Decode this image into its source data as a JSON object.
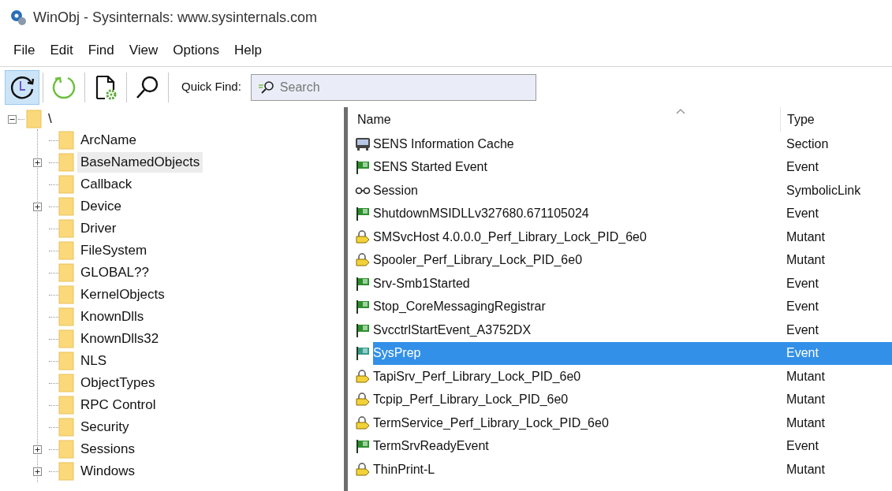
{
  "window": {
    "title": "WinObj - Sysinternals: www.sysinternals.com"
  },
  "menu": [
    "File",
    "Edit",
    "Find",
    "View",
    "Options",
    "Help"
  ],
  "toolbar": [
    {
      "kind": "history",
      "pressed": true
    },
    {
      "kind": "refresh",
      "pressed": false
    },
    {
      "kind": "properties",
      "pressed": false
    },
    {
      "kind": "find",
      "pressed": false
    }
  ],
  "quick_find": {
    "label": "Quick Find:",
    "placeholder": "Search"
  },
  "tree": {
    "label": "\\",
    "expanded": true,
    "children": [
      {
        "label": "ArcName",
        "expandable": false,
        "hovered": false
      },
      {
        "label": "BaseNamedObjects",
        "expandable": true,
        "hovered": true
      },
      {
        "label": "Callback",
        "expandable": false,
        "hovered": false
      },
      {
        "label": "Device",
        "expandable": true,
        "hovered": false
      },
      {
        "label": "Driver",
        "expandable": false,
        "hovered": false
      },
      {
        "label": "FileSystem",
        "expandable": false,
        "hovered": false
      },
      {
        "label": "GLOBAL??",
        "expandable": false,
        "hovered": false
      },
      {
        "label": "KernelObjects",
        "expandable": false,
        "hovered": false
      },
      {
        "label": "KnownDlls",
        "expandable": false,
        "hovered": false
      },
      {
        "label": "KnownDlls32",
        "expandable": false,
        "hovered": false
      },
      {
        "label": "NLS",
        "expandable": false,
        "hovered": false
      },
      {
        "label": "ObjectTypes",
        "expandable": false,
        "hovered": false
      },
      {
        "label": "RPC Control",
        "expandable": false,
        "hovered": false
      },
      {
        "label": "Security",
        "expandable": false,
        "hovered": false
      },
      {
        "label": "Sessions",
        "expandable": true,
        "hovered": false
      },
      {
        "label": "Windows",
        "expandable": true,
        "hovered": false
      }
    ]
  },
  "table": {
    "columns": [
      {
        "label": "Name",
        "sorted": true
      },
      {
        "label": "Type",
        "sorted": false
      }
    ],
    "rows": [
      {
        "kind": "section",
        "name": "SENS Information Cache",
        "type": "Section",
        "selected": false
      },
      {
        "kind": "event",
        "name": "SENS Started Event",
        "type": "Event",
        "selected": false
      },
      {
        "kind": "link",
        "name": "Session",
        "type": "SymbolicLink",
        "selected": false
      },
      {
        "kind": "event",
        "name": "ShutdownMSIDLLv327680.671105024",
        "type": "Event",
        "selected": false
      },
      {
        "kind": "mutant",
        "name": "SMSvcHost 4.0.0.0_Perf_Library_Lock_PID_6e0",
        "type": "Mutant",
        "selected": false
      },
      {
        "kind": "mutant",
        "name": "Spooler_Perf_Library_Lock_PID_6e0",
        "type": "Mutant",
        "selected": false
      },
      {
        "kind": "event",
        "name": "Srv-Smb1Started",
        "type": "Event",
        "selected": false
      },
      {
        "kind": "event",
        "name": "Stop_CoreMessagingRegistrar",
        "type": "Event",
        "selected": false
      },
      {
        "kind": "event",
        "name": "SvcctrlStartEvent_A3752DX",
        "type": "Event",
        "selected": false
      },
      {
        "kind": "event",
        "name": "SysPrep",
        "type": "Event",
        "selected": true
      },
      {
        "kind": "mutant",
        "name": "TapiSrv_Perf_Library_Lock_PID_6e0",
        "type": "Mutant",
        "selected": false
      },
      {
        "kind": "mutant",
        "name": "Tcpip_Perf_Library_Lock_PID_6e0",
        "type": "Mutant",
        "selected": false
      },
      {
        "kind": "mutant",
        "name": "TermService_Perf_Library_Lock_PID_6e0",
        "type": "Mutant",
        "selected": false
      },
      {
        "kind": "event",
        "name": "TermSrvReadyEvent",
        "type": "Event",
        "selected": false
      },
      {
        "kind": "mutant",
        "name": "ThinPrint-L",
        "type": "Mutant",
        "selected": false
      }
    ]
  }
}
